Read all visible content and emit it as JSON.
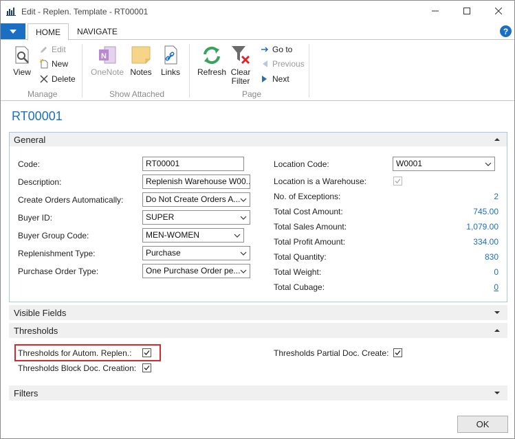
{
  "window": {
    "title": "Edit - Replen. Template - RT00001"
  },
  "ribbon": {
    "tabs": [
      {
        "label": "HOME",
        "active": true
      },
      {
        "label": "NAVIGATE",
        "active": false
      }
    ],
    "groups": {
      "manage": {
        "label": "Manage",
        "view": "View",
        "edit": "Edit",
        "new": "New",
        "delete": "Delete"
      },
      "show_attached": {
        "label": "Show Attached",
        "onenote": "OneNote",
        "notes": "Notes",
        "links": "Links"
      },
      "page": {
        "label": "Page",
        "refresh": "Refresh",
        "clear_filter_line1": "Clear",
        "clear_filter_line2": "Filter",
        "go_to": "Go to",
        "previous": "Previous",
        "next": "Next"
      }
    }
  },
  "record": {
    "title": "RT00001"
  },
  "general": {
    "title": "General",
    "left": {
      "code_label": "Code:",
      "code_value": "RT00001",
      "description_label": "Description:",
      "description_value": "Replenish Warehouse W00...",
      "create_orders_label": "Create Orders Automatically:",
      "create_orders_value": "Do Not Create Orders A...",
      "buyer_id_label": "Buyer ID:",
      "buyer_id_value": "SUPER",
      "buyer_group_label": "Buyer Group Code:",
      "buyer_group_value": "MEN-WOMEN",
      "replen_type_label": "Replenishment Type:",
      "replen_type_value": "Purchase",
      "po_type_label": "Purchase Order Type:",
      "po_type_value": "One Purchase Order pe..."
    },
    "right": {
      "location_code_label": "Location Code:",
      "location_code_value": "W0001",
      "is_warehouse_label": "Location is a Warehouse:",
      "exceptions_label": "No. of Exceptions:",
      "exceptions_value": "2",
      "total_cost_label": "Total Cost Amount:",
      "total_cost_value": "745.00",
      "total_sales_label": "Total Sales Amount:",
      "total_sales_value": "1,079.00",
      "total_profit_label": "Total Profit Amount:",
      "total_profit_value": "334.00",
      "total_qty_label": "Total Quantity:",
      "total_qty_value": "830",
      "total_weight_label": "Total Weight:",
      "total_weight_value": "0",
      "total_cubage_label": "Total Cubage:",
      "total_cubage_value": "0"
    }
  },
  "visible_fields": {
    "title": "Visible Fields"
  },
  "thresholds": {
    "title": "Thresholds",
    "autom_replen_label": "Thresholds for Autom. Replen.:",
    "block_doc_label": "Thresholds Block Doc. Creation:",
    "partial_doc_label": "Thresholds Partial Doc. Create:"
  },
  "filters": {
    "title": "Filters"
  },
  "footer": {
    "ok": "OK"
  },
  "colors": {
    "accent": "#1a6fc2",
    "highlight": "#d9262c"
  }
}
